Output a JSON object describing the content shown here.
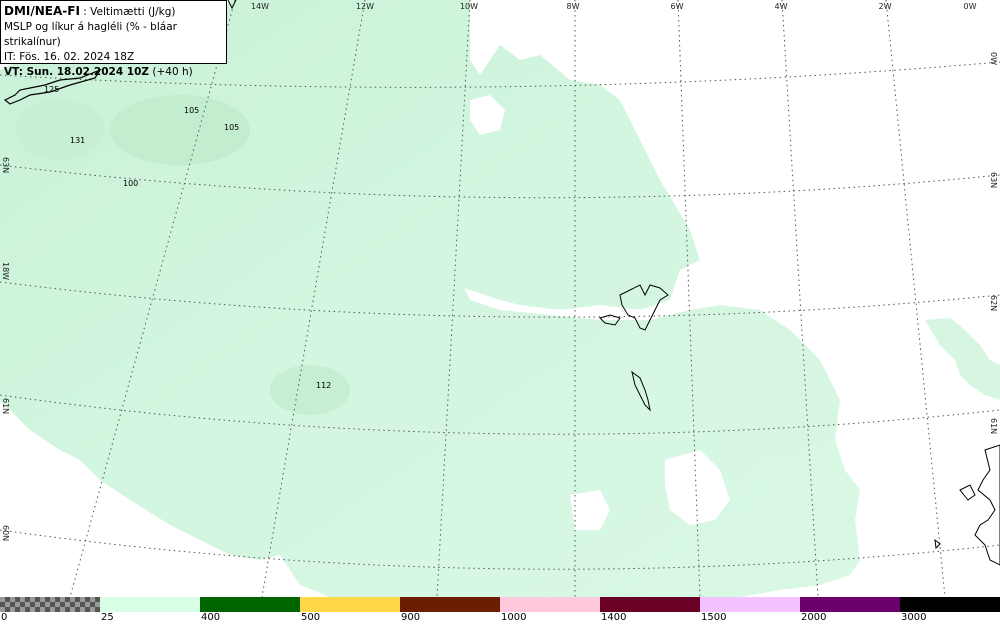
{
  "info": {
    "title": "DMI/NEA-FI",
    "title_suffix": ": Veltimætti (J/kg)",
    "line2": "MSLP og líkur á hagléli (% - bláar strikalínur)",
    "line3": "IT: Fös. 16. 02. 2024 18Z",
    "vt_bold": "VT: Sun. 18.02.2024 10Z",
    "vt_rest": "(+40 h)"
  },
  "map": {
    "longitude_labels": [
      "14W",
      "12W",
      "10W",
      "8W",
      "6W",
      "4W",
      "2W",
      "0W"
    ],
    "latitude_labels_left": [
      "63N",
      "18W",
      "61N",
      "60N"
    ],
    "latitude_labels_right": [
      "0W",
      "63N",
      "62N",
      "61N"
    ],
    "values": [
      "125",
      "105",
      "105",
      "131",
      "100",
      "112"
    ],
    "fill_color": "#d4f7e2",
    "fill_dark_color": "#c4eed0"
  },
  "legend": {
    "colors": [
      "checker",
      "#d8ffe6",
      "#006400",
      "#ffd84a",
      "#6b1e00",
      "#ffc8dc",
      "#6b0026",
      "#f3c2ff",
      "#6b006b",
      "#000000"
    ],
    "labels": [
      "0",
      "25",
      "400",
      "500",
      "900",
      "1000",
      "1400",
      "1500",
      "2000",
      "3000"
    ]
  }
}
